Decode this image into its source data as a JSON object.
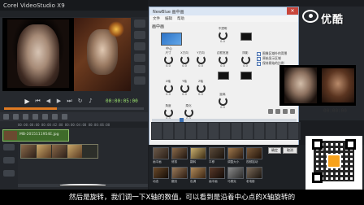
{
  "app": {
    "title": "Corel VideoStudio X9",
    "timecode": "00:00:05:00"
  },
  "timeline": {
    "ruler": "00:00:00:00    00:00:02:00    00:00:04:00    00:00:06:00",
    "clip_label": "MB-2015111954E.jpg"
  },
  "dialog": {
    "title": "NewBlue 画中画",
    "menu": [
      "文件",
      "编辑",
      "帮助"
    ],
    "section_title": "画中画",
    "swatch_label": "中心",
    "knobs": [
      {
        "label": "尺寸",
        "value": "0.0"
      },
      {
        "label": "X方向",
        "value": "0.0"
      },
      {
        "label": "Y方向",
        "value": "0.0"
      },
      {
        "label": "不透明",
        "value": "0.0"
      },
      {
        "label": "边框宽度",
        "value": "0.0"
      },
      {
        "label": "X轴",
        "value": "0.0"
      },
      {
        "label": "Y轴",
        "value": "0.0"
      },
      {
        "label": "Z轴",
        "value": "0.0"
      },
      {
        "label": "阴影",
        "value": "0.0"
      },
      {
        "label": "角度",
        "value": "0.0"
      },
      {
        "label": "柔化",
        "value": "0.0"
      },
      {
        "label": "距离",
        "value": "0.0"
      }
    ],
    "checkboxes": [
      {
        "label": "图像区域外的背景",
        "checked": true
      },
      {
        "label": "原始显示区域",
        "checked": true
      },
      {
        "label": "保持原始的比例",
        "checked": true
      }
    ],
    "time": "00:00:00",
    "ok": "确定",
    "cancel": "取消"
  },
  "logo": {
    "text": "优酷"
  },
  "library": {
    "thumbs": [
      "画中画",
      "修剪",
      "翻转",
      "平移",
      "调整大小",
      "视频摇动",
      "动态",
      "翻页",
      "色调",
      "画中画",
      "马赛克",
      "老电影"
    ]
  },
  "subtitle": "然后是旋转，我们调一下X轴的数值，可以看到是沿着中心点的X轴旋转的"
}
